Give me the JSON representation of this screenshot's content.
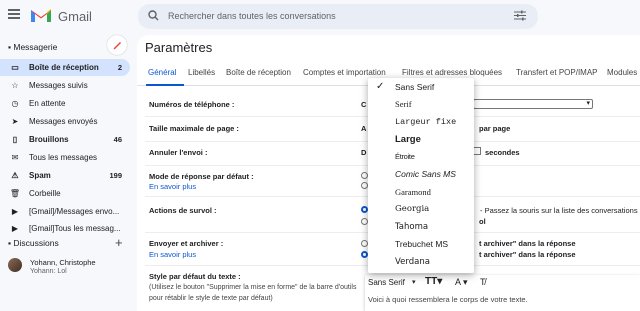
{
  "app": {
    "logo_text": "Gmail"
  },
  "search": {
    "placeholder": "Rechercher dans toutes les conversations"
  },
  "sidebar": {
    "title": "Messagerie",
    "items": [
      {
        "label": "Boîte de réception",
        "count": "2",
        "icon": "inbox-icon"
      },
      {
        "label": "Messages suivis",
        "count": "",
        "icon": "star-icon"
      },
      {
        "label": "En attente",
        "count": "",
        "icon": "clock-icon"
      },
      {
        "label": "Messages envoyés",
        "count": "",
        "icon": "send-icon"
      },
      {
        "label": "Brouillons",
        "count": "46",
        "icon": "draft-icon"
      },
      {
        "label": "Tous les messages",
        "count": "",
        "icon": "mail-icon"
      },
      {
        "label": "Spam",
        "count": "199",
        "icon": "spam-icon"
      },
      {
        "label": "Corbeille",
        "count": "",
        "icon": "trash-icon"
      },
      {
        "label": "[Gmail]/Messages envo...",
        "count": "",
        "icon": "label-icon"
      },
      {
        "label": "[Gmail]Tous les messag...",
        "count": "",
        "icon": "label-icon"
      }
    ],
    "discussions": "Discussions",
    "user": {
      "name": "Yohann, Christophe",
      "sub": "Yohann: Lol"
    }
  },
  "settings": {
    "title": "Paramètres",
    "tabs": [
      "Général",
      "Libellés",
      "Boîte de réception",
      "Comptes et importation",
      "Filtres et adresses bloquées",
      "Transfert et POP/IMAP",
      "Modules"
    ],
    "rows": {
      "phone": "Numéros de téléphone :",
      "page_size": "Taille maximale de page :",
      "undo": "Annuler l'envoi :",
      "reply": "Mode de réponse par défaut :",
      "hover": "Actions de survol :",
      "send_archive": "Envoyer et archiver :",
      "learn_more": "En savoir plus",
      "style": "Style par défaut du texte :",
      "style_note_1": "(Utilisez le bouton \"Supprimer la mise en forme\" de la barre d'outils",
      "style_note_2": "pour rétablir le style de texte par défaut)"
    },
    "right_fragments": {
      "c": "C",
      "a": "A",
      "d": "D",
      "per_page": "par page",
      "seconds": "secondes",
      "hover_text": "- Passez la souris sur la liste des conversations",
      "ol": "ol",
      "archive_1": "t archiver\" dans la réponse",
      "archive_2": "t archiver\" dans la réponse"
    },
    "editor": {
      "font": "Sans Serif",
      "size_icon": "text-size-icon",
      "color_label": "A",
      "preview": "Voici à quoi ressemblera le corps de votre texte."
    },
    "font_menu": {
      "selected": "Sans Serif",
      "options": [
        "Sans Serif",
        "Serif",
        "Largeur fixe",
        "Large",
        "Étroite",
        "Comic Sans MS",
        "Garamond",
        "Georgia",
        "Tahoma",
        "Trebuchet MS",
        "Verdana"
      ]
    }
  },
  "colors": {
    "accent": "#0b57d0",
    "gmail_red": "#ea4335",
    "active_bg": "#d3e3fd"
  }
}
